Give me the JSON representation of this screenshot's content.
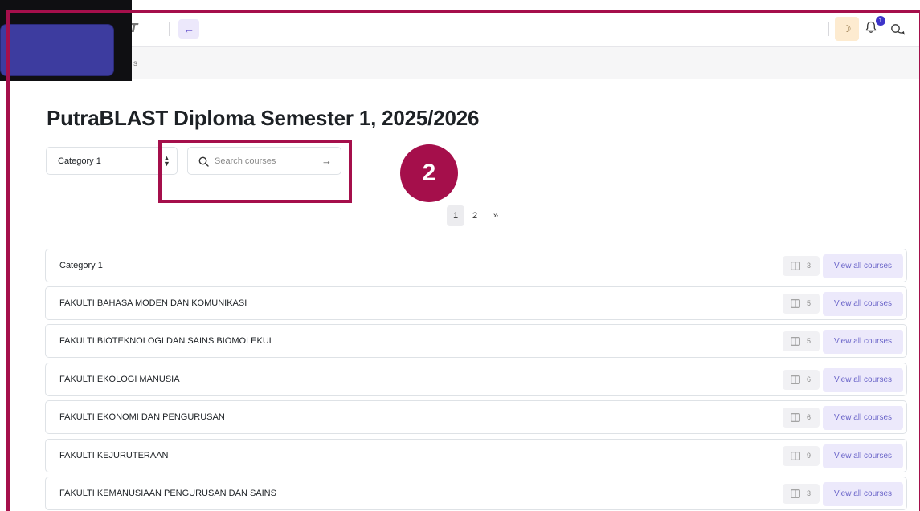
{
  "navbar": {
    "brand": "ST",
    "back_icon": "arrow-left-icon",
    "theme_icon": "moon-icon",
    "notification_count": "1",
    "notification_icon": "bell-icon",
    "messages_icon": "chat-bubbles-icon"
  },
  "breadcrumb": {
    "text": "s"
  },
  "page": {
    "title": "PutraBLAST Diploma Semester 1, 2025/2026"
  },
  "filter": {
    "category_selected": "Category 1",
    "search_placeholder": "Search courses"
  },
  "annotation": {
    "step_number": "2",
    "color": "#a50f4b"
  },
  "pagination": {
    "pages": [
      "1",
      "2"
    ],
    "active": "1",
    "next": "»"
  },
  "categories": [
    {
      "name": "Category 1",
      "count": "3",
      "action": "View all courses"
    },
    {
      "name": "FAKULTI BAHASA MODEN DAN KOMUNIKASI",
      "count": "5",
      "action": "View all courses"
    },
    {
      "name": "FAKULTI BIOTEKNOLOGI DAN SAINS BIOMOLEKUL",
      "count": "5",
      "action": "View all courses"
    },
    {
      "name": "FAKULTI EKOLOGI MANUSIA",
      "count": "6",
      "action": "View all courses"
    },
    {
      "name": "FAKULTI EKONOMI DAN PENGURUSAN",
      "count": "6",
      "action": "View all courses"
    },
    {
      "name": "FAKULTI KEJURUTERAAN",
      "count": "9",
      "action": "View all courses"
    },
    {
      "name": "FAKULTI KEMANUSIAAN PENGURUSAN DAN SAINS",
      "count": "3",
      "action": "View all courses"
    }
  ],
  "colors": {
    "accent": "#a50f4b",
    "primary": "#3d34c9",
    "view_button_text": "#6b65c9"
  }
}
